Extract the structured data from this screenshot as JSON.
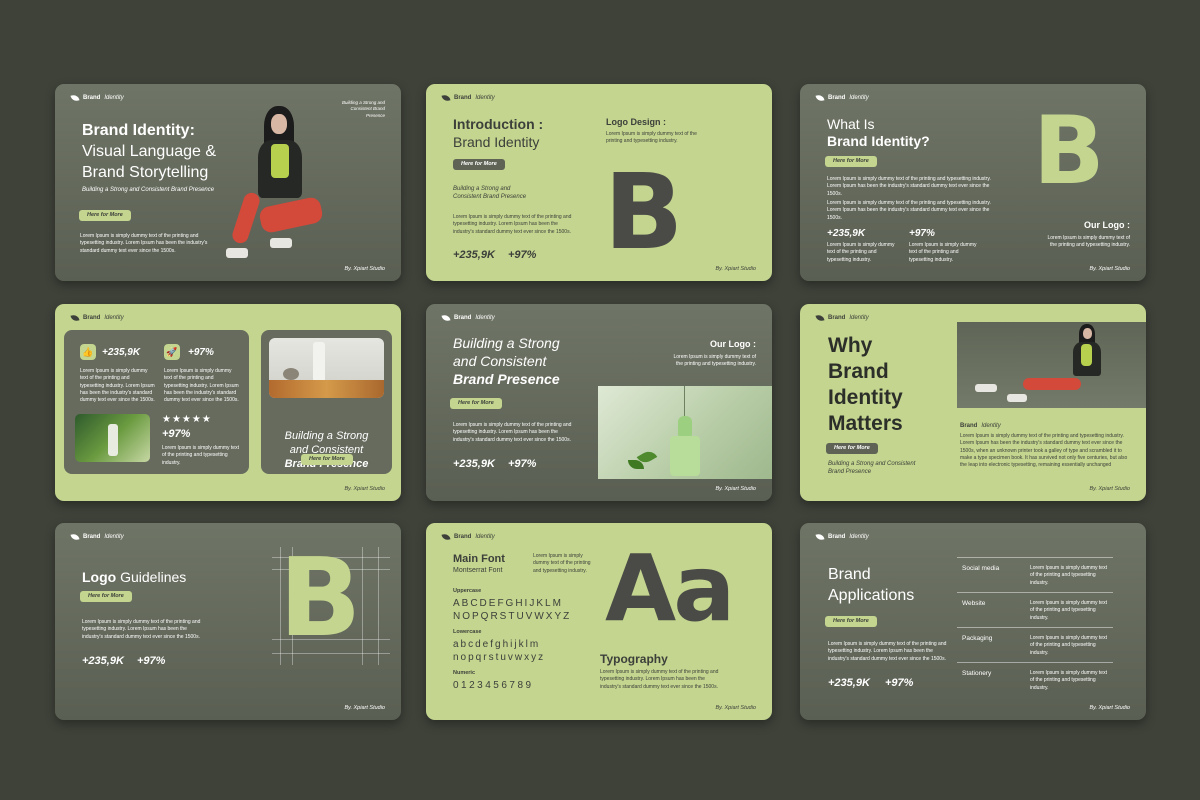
{
  "brand": {
    "name": "Brand",
    "sub": "Identity"
  },
  "common": {
    "btn": "Here for More",
    "footer": "By. Xpiart Studio",
    "stat1": "+235,9K",
    "stat2": "+97%"
  },
  "lorem": {
    "short": "Lorem Ipsum is simply dummy text of the printing and typesetting industry.",
    "long3": "Lorem Ipsum is simply dummy text of the printing and typesetting industry. Lorem Ipsum has been the industry's standard dummy text ever since the 1500s.",
    "narrow": "Lorem Ipsum is simply dummy text of the printing and typesetting industry. Lorem Ipsum has been the industry's standard dummy text ever since the 1500s.",
    "tiny": "Lorem Ipsum is simply dummy text of the printing and typesetting industry.",
    "paragraph": "Lorem Ipsum is simply dummy text of the printing and typesetting industry. Lorem Ipsum has been the industry's standard dummy text ever since the 1500s, when an unknown printer took a galley of type and scrambled it to make a type specimen book. It has survived not only five centuries, but also the leap into electronic typesetting, remaining essentially unchanged"
  },
  "s1": {
    "line1": "Brand Identity:",
    "line2": "Visual Language &",
    "line3": "Brand Storytelling",
    "subtitle": "Building a Strong and Consistent Brand Presence",
    "top_right": "Building a Strong and Consistent Brand Presence"
  },
  "s2": {
    "title_bold": "Introduction :",
    "title_reg": "Brand Identity",
    "subtitle": "Building a Strong and Consistent Brand Presence",
    "logo_title": "Logo Design :",
    "letter": "B"
  },
  "s3": {
    "title_reg": "What Is",
    "title_bold": "Brand Identity?",
    "letter": "B",
    "logo_title": "Our Logo :"
  },
  "s4": {
    "rocket_stat": "+97%",
    "photo_stat": "+97%",
    "stars": "★★★★★",
    "card_line1": "Building a Strong",
    "card_line2": "and Consistent",
    "card_line3": "Brand Presence"
  },
  "s5": {
    "line1": "Building a Strong",
    "line2": "and Consistent",
    "line3": "Brand Presence",
    "logo_title": "Our Logo :"
  },
  "s6": {
    "l1": "Why",
    "l2": "Brand",
    "l3": "Identity",
    "l4": "Matters",
    "subtitle": "Building a Strong and Consistent Brand Presence"
  },
  "s7": {
    "title_bold": "Logo",
    "title_reg": "Guidelines",
    "letter": "B"
  },
  "s8": {
    "font_title": "Main Font",
    "font_name": "Montserrat Font",
    "upper_label": "Uppercase",
    "upper1": "ABCDEFGHIJKLM",
    "upper2": "NOPQRSTUVWXYZ",
    "lower_label": "Lowercase",
    "lower1": "abcdefghijklm",
    "lower2": "nopqrstuvwxyz",
    "numeric_label": "Numeric",
    "numeric": "0123456789",
    "sample": "Aa",
    "typo_title": "Typography"
  },
  "s9": {
    "line1": "Brand",
    "line2": "Applications",
    "apps": [
      {
        "name": "Social media"
      },
      {
        "name": "Website"
      },
      {
        "name": "Packaging"
      },
      {
        "name": "Stationery"
      }
    ]
  },
  "colors": {
    "background": "#3e4239",
    "lime": "#c3d58e",
    "olive": "#5e6356",
    "charcoal": "#4a4b47"
  }
}
